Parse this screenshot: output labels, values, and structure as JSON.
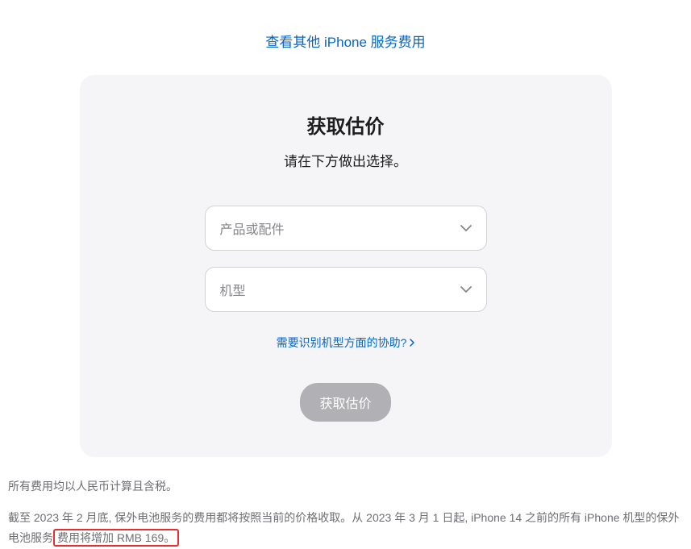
{
  "topLink": {
    "text": "查看其他 iPhone 服务费用"
  },
  "card": {
    "title": "获取估价",
    "subtitle": "请在下方做出选择。",
    "select1": {
      "placeholder": "产品或配件"
    },
    "select2": {
      "placeholder": "机型"
    },
    "helpLink": {
      "text": "需要识别机型方面的协助?"
    },
    "submitButton": {
      "label": "获取估价"
    }
  },
  "footer": {
    "line1": "所有费用均以人民币计算且含税。",
    "line2_part1": "截至 2023 年 2 月底, 保外电池服务的费用都将按照当前的价格收取。从 2023 年 3 月 1 日起, iPhone 14 之前的所有 iPhone 机型的保外电池服务",
    "line2_highlight": "费用将增加 RMB 169。"
  }
}
